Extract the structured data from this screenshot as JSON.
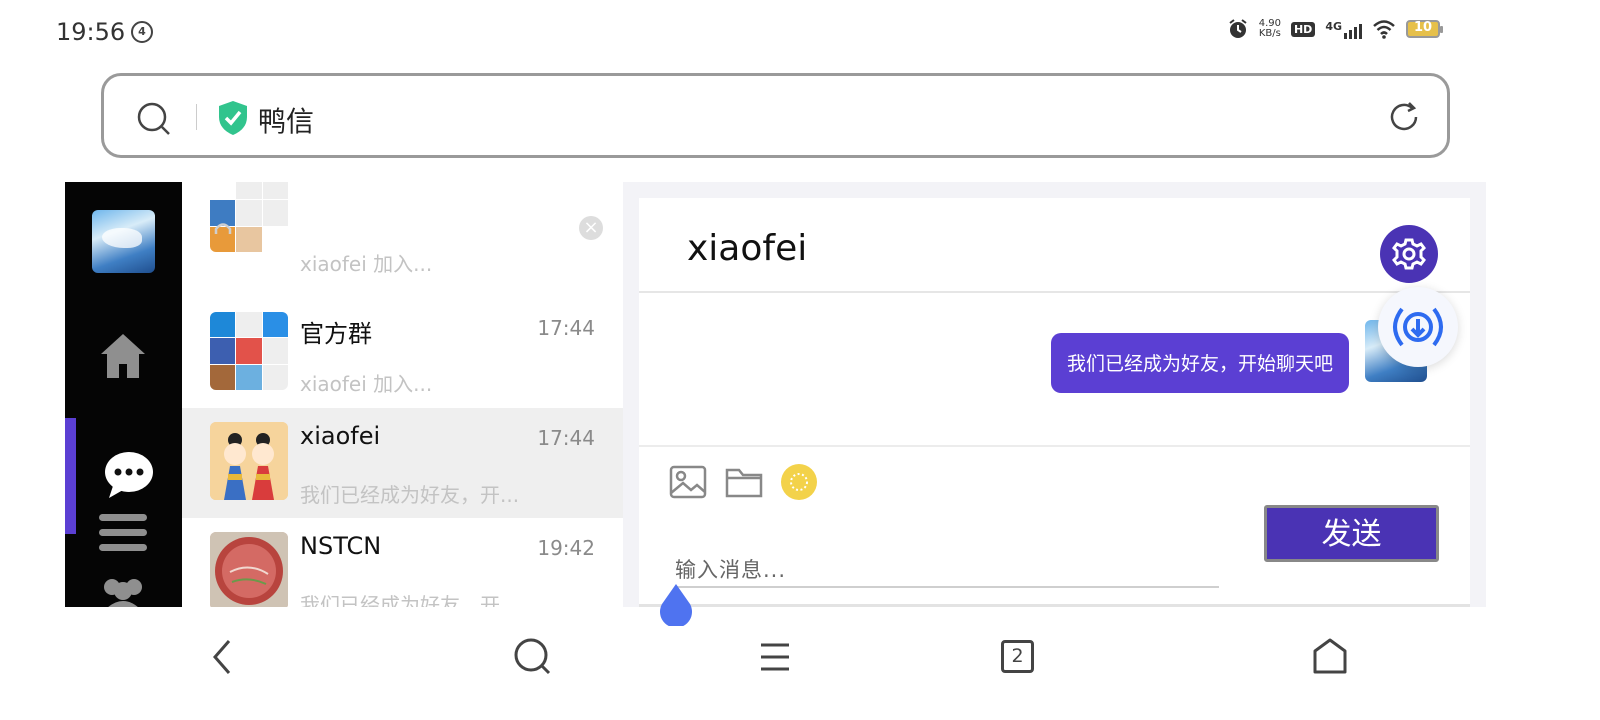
{
  "status_bar": {
    "time": "19:56",
    "badge": "4",
    "net_speed_value": "4.90",
    "net_speed_unit": "KB/s",
    "hd": "HD",
    "network": "4G",
    "battery": "10"
  },
  "address_bar": {
    "title": "鸭信"
  },
  "nav_rail": {
    "items": [
      "home",
      "chat",
      "menu",
      "contacts"
    ]
  },
  "conversations": [
    {
      "name": "",
      "time": "",
      "preview": "xiaofei 加入..."
    },
    {
      "name": "官方群",
      "time": "17:44",
      "preview": "xiaofei 加入..."
    },
    {
      "name": "xiaofei",
      "time": "17:44",
      "preview": "我们已经成为好友，开..."
    },
    {
      "name": "NSTCN",
      "time": "19:42",
      "preview": "我们已经成为好友，开..."
    }
  ],
  "chat": {
    "title": "xiaofei",
    "messages": [
      {
        "text": "我们已经成为好友，开始聊天吧",
        "from": "me"
      }
    ],
    "input_placeholder": "输入消息...",
    "send_label": "发送"
  },
  "bottom_nav": {
    "tabs_count": "2"
  },
  "colors": {
    "accent": "#5b3fd3",
    "accent_dark": "#4a33b4",
    "rail_bg": "#050505"
  }
}
